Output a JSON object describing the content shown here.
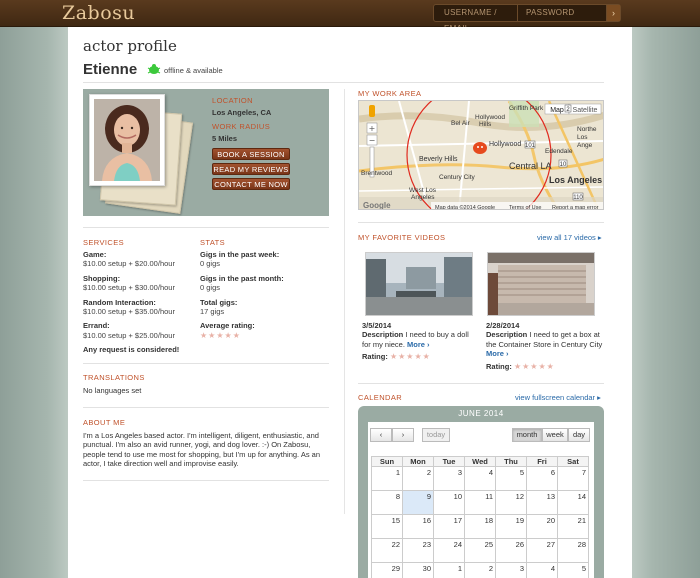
{
  "header": {
    "logo": "Zabosu",
    "login": {
      "username_placeholder": "USERNAME / EMAIL",
      "password_placeholder": "PASSWORD",
      "go_icon": "arrow-right-icon",
      "go_label": "›"
    }
  },
  "page": {
    "title": "actor profile",
    "actor_name": "Etienne",
    "status": "offline & available",
    "status_color": "#3cc93c"
  },
  "profile": {
    "location_label": "LOCATION",
    "location": "Los Angeles, CA",
    "radius_label": "WORK RADIUS",
    "radius": "5 Miles",
    "buttons": {
      "book": "BOOK A SESSION",
      "reviews": "READ MY REVIEWS",
      "contact": "CONTACT ME NOW"
    }
  },
  "services": {
    "title": "SERVICES",
    "items": [
      {
        "name": "Game:",
        "price": "$10.00 setup + $20.00/hour"
      },
      {
        "name": "Shopping:",
        "price": "$10.00 setup + $30.00/hour"
      },
      {
        "name": "Random Interaction:",
        "price": "$10.00 setup + $35.00/hour"
      },
      {
        "name": "Errand:",
        "price": "$10.00 setup + $25.00/hour"
      }
    ],
    "any_request": "Any request is considered!"
  },
  "stats": {
    "title": "STATS",
    "items": [
      {
        "name": "Gigs in the past week:",
        "value": "0 gigs"
      },
      {
        "name": "Gigs in the past month:",
        "value": "0 gigs"
      },
      {
        "name": "Total gigs:",
        "value": "17 gigs"
      }
    ],
    "rating_label": "Average rating:",
    "rating_stars": "★★★★★"
  },
  "translations": {
    "title": "TRANSLATIONS",
    "text": "No languages set"
  },
  "about": {
    "title": "ABOUT ME",
    "text": "I'm a Los Angeles based actor. I'm intelligent, diligent, enthusiastic, and punctual. I'm also an avid runner, yogi, and dog lover.  :-) On Zabosu, people tend to use me most for shopping, but I'm up for anything. As an actor, I take direction well and improvise easily."
  },
  "work_area": {
    "title": "MY WORK AREA",
    "map_tabs": [
      "Map",
      "Satellite"
    ],
    "places": [
      "Griffith Park",
      "Hollywood Hills",
      "Hollywood",
      "Bel Air",
      "Beverly Hills",
      "Central LA",
      "Edendale",
      "Northeast Los Angeles",
      "Los Angeles",
      "Brentwood",
      "Century City",
      "West Los Angeles"
    ],
    "road_labels": [
      "101",
      "10",
      "2",
      "110"
    ],
    "footer_data": "Map data ©2014 Google",
    "footer_terms": "Terms of Use",
    "footer_report": "Report a map error",
    "google": "Google"
  },
  "videos": {
    "title": "MY FAVORITE VIDEOS",
    "view_all": "view all 17 videos ▸",
    "items": [
      {
        "date": "3/5/2014",
        "desc_label": "Description",
        "desc": "I need to buy a doll for my niece.",
        "more": "More ›",
        "rating_label": "Rating:",
        "stars": "★★★★★"
      },
      {
        "date": "2/28/2014",
        "desc_label": "Description",
        "desc": "I need to get a box at the Container Store in Century City",
        "more": "More ›",
        "rating_label": "Rating:",
        "stars": "★★★★★"
      }
    ]
  },
  "calendar": {
    "title": "CALENDAR",
    "fullscreen": "view fullscreen calendar ▸",
    "month": "JUNE 2014",
    "prev": "‹",
    "next": "›",
    "today": "today",
    "views": [
      "month",
      "week",
      "day"
    ],
    "days": [
      "Sun",
      "Mon",
      "Tue",
      "Wed",
      "Thu",
      "Fri",
      "Sat"
    ],
    "weeks": [
      [
        "1",
        "2",
        "3",
        "4",
        "5",
        "6",
        "7"
      ],
      [
        "8",
        "9",
        "10",
        "11",
        "12",
        "13",
        "14"
      ],
      [
        "15",
        "16",
        "17",
        "18",
        "19",
        "20",
        "21"
      ],
      [
        "22",
        "23",
        "24",
        "25",
        "26",
        "27",
        "28"
      ],
      [
        "29",
        "30",
        "1",
        "2",
        "3",
        "4",
        "5"
      ]
    ]
  }
}
